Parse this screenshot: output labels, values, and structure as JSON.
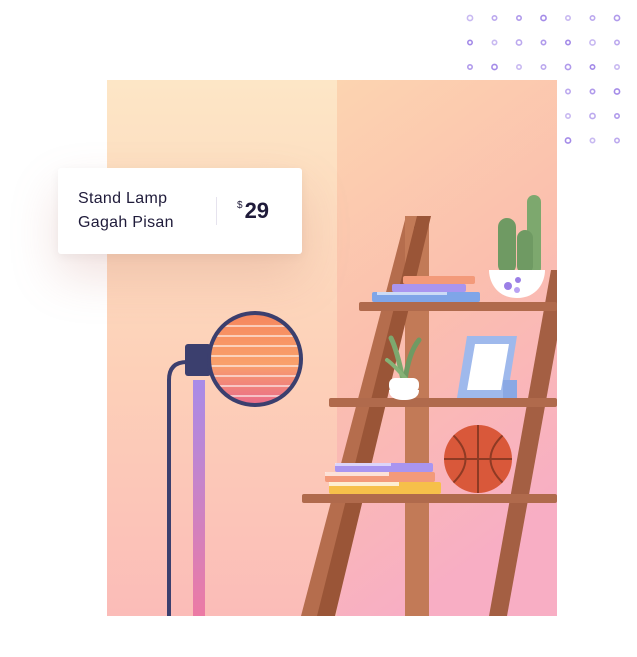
{
  "product_card": {
    "name_line1": "Stand Lamp",
    "name_line2": "Gagah Pisan",
    "currency": "$",
    "price": "29"
  },
  "colors": {
    "background": "#ffffff",
    "dot_grid": "#9b7fe6",
    "text": "#1f1b3a",
    "scene_peach": "#fde2c4",
    "scene_pink": "#f9b2c6",
    "wood": "#b06a4c",
    "basketball": "#d9583a"
  },
  "illustration": {
    "objects": [
      "stand-lamp",
      "ladder-shelf",
      "books",
      "cactus-pot",
      "small-plant",
      "photo-frame",
      "basketball"
    ]
  }
}
